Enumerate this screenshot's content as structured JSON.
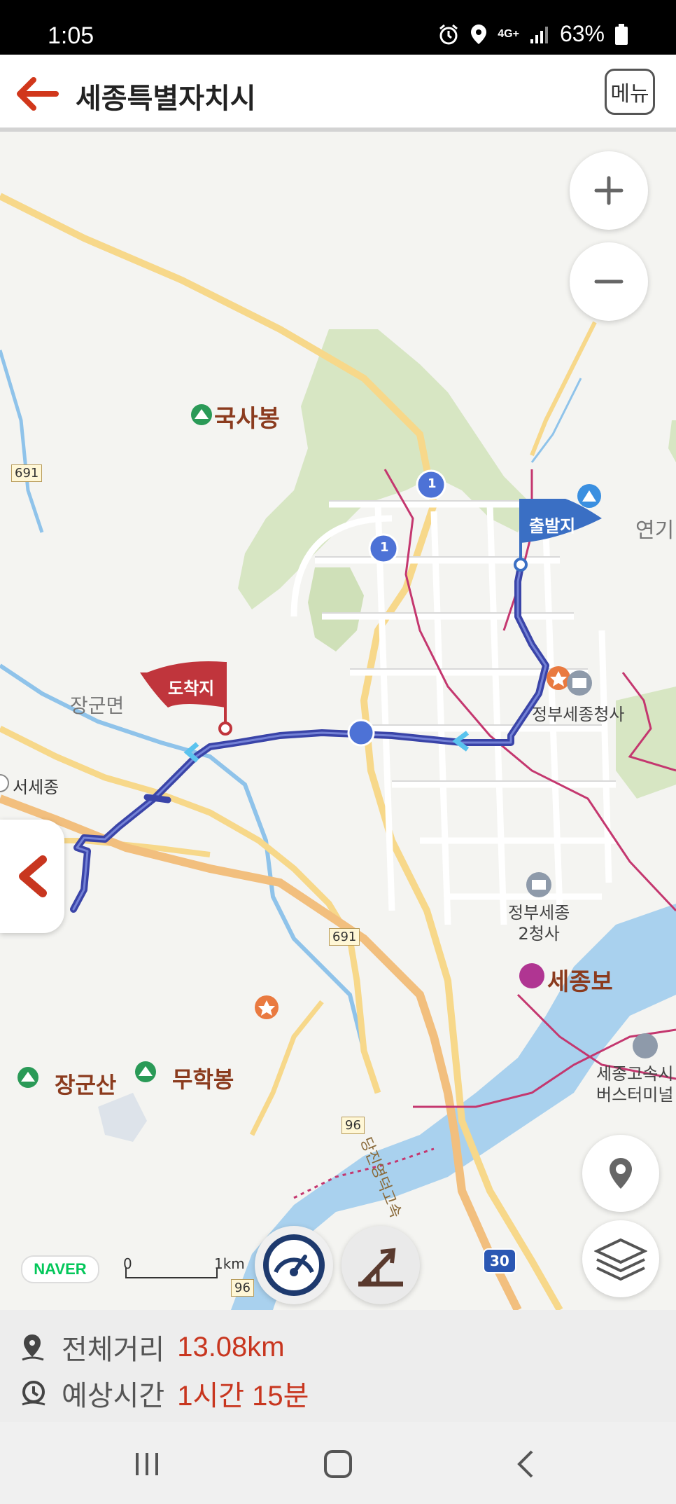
{
  "status_bar": {
    "time": "1:05",
    "network": "4G+",
    "battery": "63%"
  },
  "header": {
    "title": "세종특별자치시",
    "menu_label": "메뉴"
  },
  "map": {
    "places": {
      "guksabong": "국사봉",
      "janggun_myeon": "장군면",
      "seosejong": "서세종",
      "yeongi": "연기",
      "gov_complex": "정부세종청사",
      "gov_complex2": "정부세종\n2청사",
      "sejongbo": "세종보",
      "janggunsan": "장군산",
      "muhakbong": "무학봉",
      "bus_terminal": "세종고속시\n버스터미널",
      "expressway": "당진영덕고속"
    },
    "markers": {
      "start": "출발지",
      "end": "도착지"
    },
    "road_numbers": {
      "r691_a": "691",
      "r691_b": "691",
      "r1_a": "1",
      "r1_b": "1",
      "r96_a": "96",
      "r96_b": "96",
      "r30": "30"
    },
    "scale": {
      "start": "0",
      "end": "1km"
    },
    "attribution": "NAVER"
  },
  "route_info": {
    "distance_label": "전체거리",
    "distance_value": "13.08km",
    "time_label": "예상시간",
    "time_value": "1시간 15분"
  },
  "colors": {
    "accent": "#c8361f",
    "route": "#3a44a8",
    "start_flag": "#3a6fc4",
    "end_flag": "#c0353c"
  }
}
